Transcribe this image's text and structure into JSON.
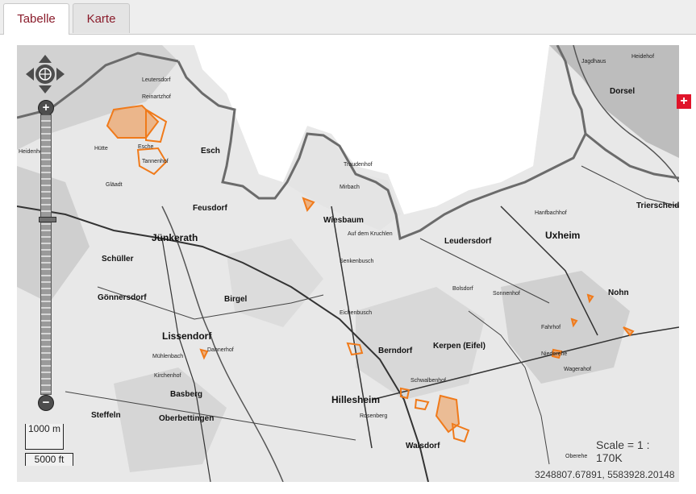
{
  "tabs": [
    {
      "label": "Tabelle",
      "active": true
    },
    {
      "label": "Karte",
      "active": false
    }
  ],
  "map": {
    "scale_text": "Scale = 1 : 170K",
    "coordinates": "3248807.67891, 5583928.20148",
    "scaleline": {
      "top": "1000 m",
      "bottom": "5000 ft"
    },
    "zoom_level_fraction": 0.63,
    "accent_color": "#f07a1a",
    "places_large": [
      "Jünkerath",
      "Wiesbaum",
      "Uxheim",
      "Hillesheim",
      "Lissendorf",
      "Schüller",
      "Gönnersdorf",
      "Birgel",
      "Berndorf",
      "Walsdorf",
      "Steffeln",
      "Basberg",
      "Oberbettingen",
      "Feusdorf",
      "Esch",
      "Dorsel",
      "Nohn",
      "Trierscheid",
      "Kerpen (Eifel)",
      "Leudersdorf"
    ],
    "places_small": [
      "Leutersdorf",
      "Reinartzhof",
      "Gläadt",
      "Heidenhof",
      "Hütte",
      "Mirbach",
      "Traudenhof",
      "Esche",
      "Tannenhof",
      "Auf dem Kruchlen",
      "Senkenbusch",
      "Eichenbusch",
      "Mühlenbach",
      "Dahnerhof",
      "Kirchenhof",
      "Rosenberg",
      "Bolsdorf",
      "Hanfbachhof",
      "Niederehe",
      "Schwalbenhof",
      "Oberehe",
      "Sonnenhof",
      "Wagerahof",
      "Fahrhof",
      "Jagdhaus",
      "Heidehof"
    ]
  }
}
